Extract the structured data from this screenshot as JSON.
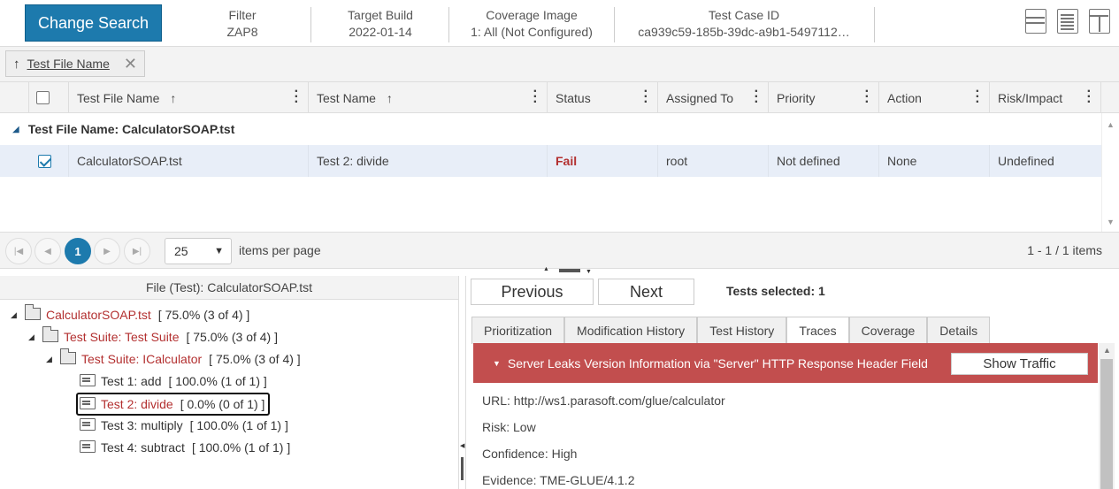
{
  "header": {
    "change_search": "Change Search",
    "columns": [
      {
        "label": "Filter",
        "value": "ZAP8"
      },
      {
        "label": "Target Build",
        "value": "2022-01-14"
      },
      {
        "label": "Coverage Image",
        "value": "1: All (Not Configured)"
      },
      {
        "label": "Test Case ID",
        "value": "ca939c59-185b-39dc-a9b1-5497112…"
      }
    ]
  },
  "groupbar": {
    "chip_label": "Test File Name"
  },
  "grid": {
    "columns": [
      "Test File Name",
      "Test Name",
      "Status",
      "Assigned To",
      "Priority",
      "Action",
      "Risk/Impact"
    ],
    "group_label": "Test File Name: CalculatorSOAP.tst",
    "rows": [
      {
        "file": "CalculatorSOAP.tst",
        "test": "Test 2: divide",
        "status": "Fail",
        "assigned": "root",
        "priority": "Not defined",
        "action": "None",
        "risk": "Undefined"
      }
    ]
  },
  "pager": {
    "page": "1",
    "page_size": "25",
    "per_page_label": "items per page",
    "summary": "1 - 1 / 1 items"
  },
  "tree": {
    "title": "File (Test): CalculatorSOAP.tst",
    "nodes": [
      {
        "label": "CalculatorSOAP.tst",
        "stat": "[ 75.0% (3 of 4) ]"
      },
      {
        "label": "Test Suite: Test Suite",
        "stat": "[ 75.0% (3 of 4) ]"
      },
      {
        "label": "Test Suite: ICalculator",
        "stat": "[ 75.0% (3 of 4) ]"
      },
      {
        "label": "Test 1: add",
        "stat": "[ 100.0% (1 of 1) ]"
      },
      {
        "label": "Test 2: divide",
        "stat": "[ 0.0% (0 of 1) ]"
      },
      {
        "label": "Test 3: multiply",
        "stat": "[ 100.0% (1 of 1) ]"
      },
      {
        "label": "Test 4: subtract",
        "stat": "[ 100.0% (1 of 1) ]"
      }
    ]
  },
  "detail": {
    "previous": "Previous",
    "next": "Next",
    "tests_selected": "Tests selected: 1",
    "tabs": [
      "Prioritization",
      "Modification History",
      "Test History",
      "Traces",
      "Coverage",
      "Details"
    ],
    "active_tab": "Traces",
    "alert": "Server Leaks Version Information via \"Server\" HTTP Response Header Field",
    "show_traffic": "Show Traffic",
    "lines": [
      "URL: http://ws1.parasoft.com/glue/calculator",
      "Risk: Low",
      "Confidence: High",
      "Evidence: TME-GLUE/4.1.2"
    ]
  },
  "colors": {
    "accent": "#1d7aad",
    "alert": "#c24e4e",
    "fail": "#b33030",
    "row_selected": "#e8eef8"
  }
}
